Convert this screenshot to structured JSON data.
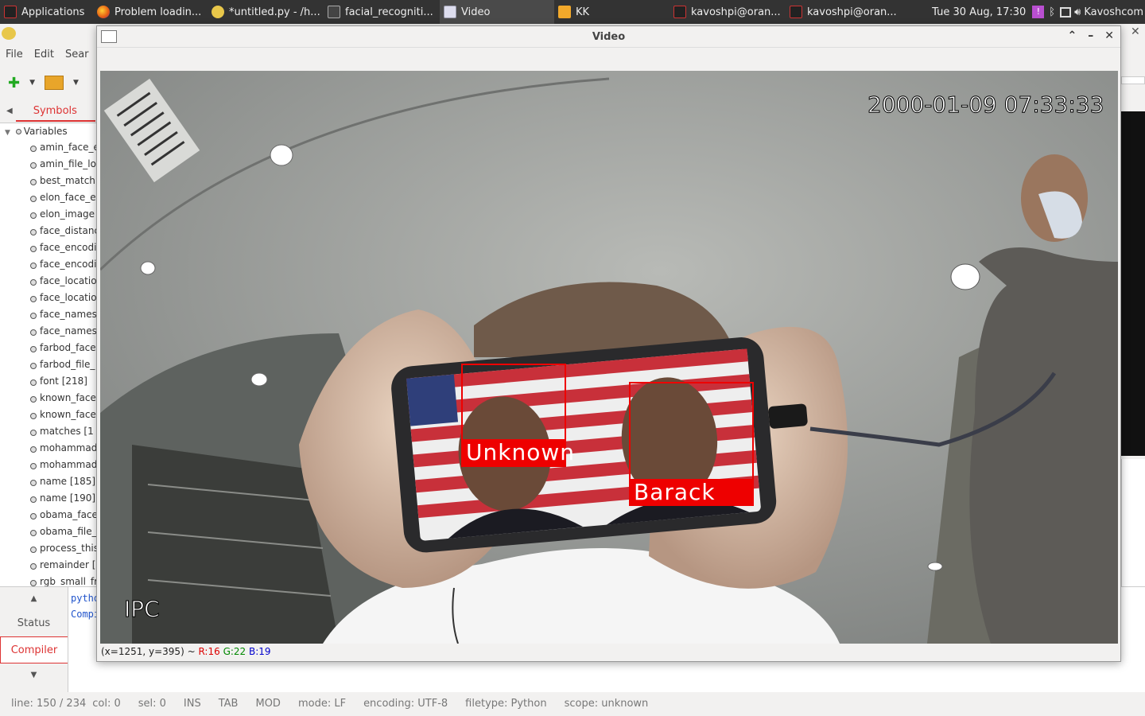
{
  "taskbar": {
    "items": [
      {
        "label": "Applications",
        "icon": "terminal-icon",
        "active": false
      },
      {
        "label": "Problem loadin...",
        "icon": "firefox-icon",
        "active": false
      },
      {
        "label": "*untitled.py - /h...",
        "icon": "geany-icon",
        "active": false
      },
      {
        "label": "facial_recogniti...",
        "icon": "terminal-icon",
        "active": false
      },
      {
        "label": "Video",
        "icon": "window-icon",
        "active": true
      },
      {
        "label": "KK",
        "icon": "folder-icon",
        "active": false
      },
      {
        "label": "kavoshpi@oran...",
        "icon": "terminal-icon",
        "active": false
      },
      {
        "label": "kavoshpi@oran...",
        "icon": "terminal-icon",
        "active": false
      }
    ],
    "clock": "Tue 30 Aug, 17:30",
    "user": "Kavoshcom"
  },
  "geany": {
    "menu": [
      "File",
      "Edit",
      "Sear"
    ],
    "sidebar_tab": "Symbols",
    "tree_root": "Variables",
    "variables": [
      "amin_face_e",
      "amin_file_lo",
      "best_match",
      "elon_face_e",
      "elon_image",
      "face_distanc",
      "face_encodi",
      "face_encodi",
      "face_locatio",
      "face_locatio",
      "face_names",
      "face_names",
      "farbod_face",
      "farbod_file_",
      "font [218]",
      "known_face",
      "known_face",
      "matches [1",
      "mohammad",
      "mohammad",
      "name [185]",
      "name [190]",
      "obama_face",
      "obama_file_",
      "process_this",
      "remainder [",
      "rgb_small_fr"
    ],
    "msg_tabs": [
      "Status",
      "Compiler"
    ],
    "msg_lines": [
      "pytho",
      "Compi"
    ],
    "status": {
      "line": "line: 150 / 234",
      "col": "col: 0",
      "sel": "sel: 0",
      "ins": "INS",
      "tab": "TAB",
      "mod": "MOD",
      "mode": "mode: LF",
      "encoding": "encoding: UTF-8",
      "filetype": "filetype: Python",
      "scope": "scope: unknown"
    }
  },
  "video_window": {
    "title": "Video",
    "timestamp": "2000-01-09 07:33:33",
    "corner_text": "IPC",
    "faces": [
      {
        "label": "Unknown"
      },
      {
        "label": "Barack"
      }
    ],
    "pixel_readout": {
      "coords": "(x=1251, y=395) ~",
      "r": "R:16",
      "g": "G:22",
      "b": "B:19"
    }
  }
}
